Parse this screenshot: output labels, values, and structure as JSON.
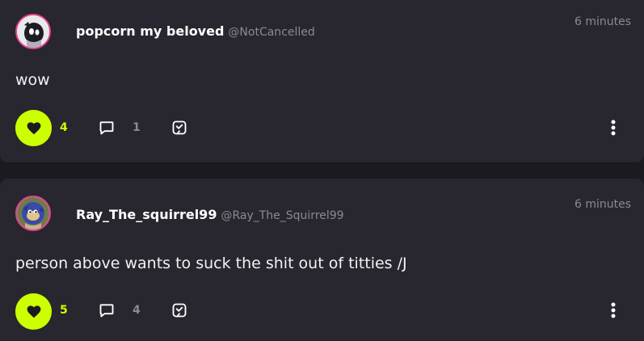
{
  "posts": [
    {
      "display_name": "popcorn my beloved",
      "handle": "@NotCancelled",
      "time": "6 minutes",
      "content": "wow",
      "likes": "4",
      "comments": "1",
      "liked": true,
      "avatar_icon": "avatar-image"
    },
    {
      "display_name": "Ray_The_squirrel99",
      "handle": "@Ray_The_Squirrel99",
      "time": "6 minutes",
      "content": "person above wants to suck the shit out of titties /J",
      "likes": "5",
      "comments": "4",
      "liked": true,
      "avatar_icon": "avatar-image"
    }
  ],
  "icons": {
    "like": "heart-icon",
    "comment": "comment-bubble-icon",
    "share": "share-tag-icon",
    "more": "vertical-ellipsis-icon"
  },
  "colors": {
    "accent": "#ccff00",
    "card_background": "#28262f",
    "page_background": "#1b1a21",
    "avatar_ring": "#e4418f",
    "muted_text": "#8b8991"
  }
}
